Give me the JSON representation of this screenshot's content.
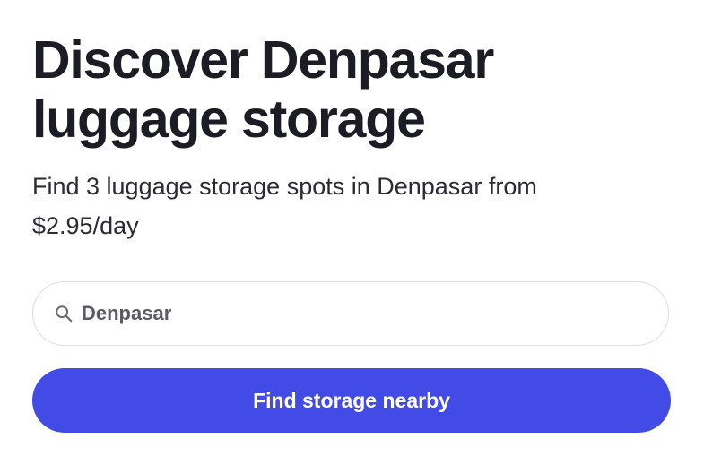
{
  "hero": {
    "title": "Discover Denpasar luggage storage",
    "subtitle": "Find 3 luggage storage spots in Denpasar from $2.95/day"
  },
  "search": {
    "icon": "search-icon",
    "value": "Denpasar"
  },
  "cta": {
    "label": "Find storage nearby",
    "color": "#434be7"
  }
}
